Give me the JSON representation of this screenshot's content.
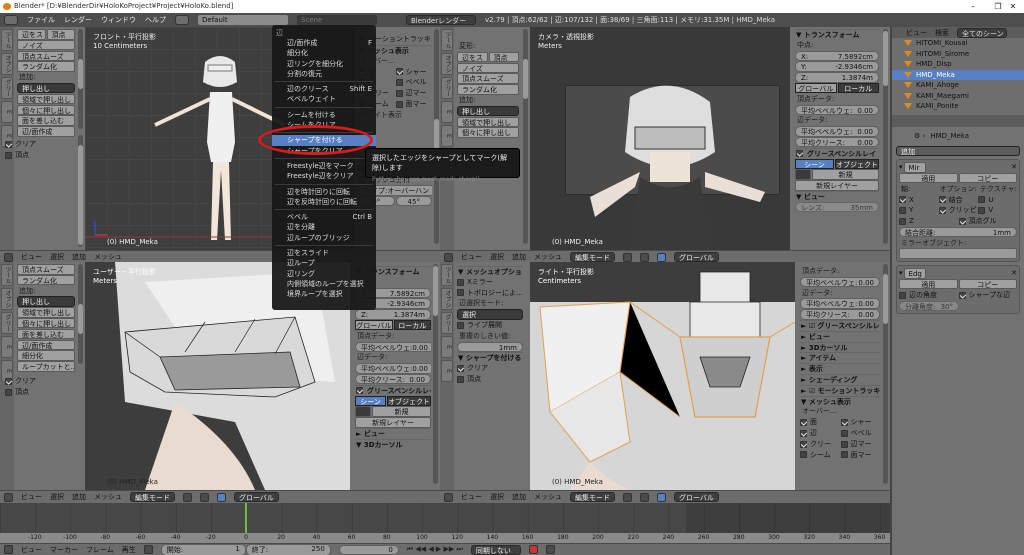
{
  "window": {
    "title": "Blender* [D:¥BlenderDir¥HoloKoProject¥Project¥HoloKo.blend]",
    "minimize": "–",
    "maximize": "❐",
    "close": "✕"
  },
  "topbar": {
    "menus": [
      "ファイル",
      "レンダー",
      "ウィンドウ",
      "ヘルプ"
    ],
    "layout": "Default",
    "scene": "Scene",
    "engine": "Blenderレンダー",
    "stats": "v2.79 | 頂点:62/62 | 辺:107/132 | 面:38/69 | 三角面:113 | メモリ:31.35M | HMD_Meka"
  },
  "tabs": [
    "ツール",
    "オプション",
    "グリース",
    "E",
    "E"
  ],
  "shelf_tl": [
    {
      "t": "btns",
      "items": [
        "辺をス",
        "頂点"
      ]
    },
    {
      "t": "btn",
      "text": "ノイズ"
    },
    {
      "t": "btn",
      "text": "頂点スムーズ"
    },
    {
      "t": "btn",
      "text": "ランダム化"
    },
    {
      "t": "label",
      "text": "追加:"
    },
    {
      "t": "dd",
      "text": "押し出し"
    },
    {
      "t": "btn",
      "text": "領域で押し出し"
    },
    {
      "t": "btn",
      "text": "個々に押し出し"
    },
    {
      "t": "btn",
      "text": "面を差し込む"
    },
    {
      "t": "btn",
      "text": "辺/面作成"
    }
  ],
  "shelf_tl_op": [
    {
      "t": "check",
      "text": "クリア",
      "checked": true
    },
    {
      "t": "check",
      "text": "頂点",
      "checked": false
    }
  ],
  "shelf_tm": [
    {
      "t": "label",
      "text": "変形:"
    },
    {
      "t": "btns",
      "items": [
        "辺をス",
        "頂点"
      ]
    },
    {
      "t": "btn",
      "text": "ノイズ"
    },
    {
      "t": "btn",
      "text": "頂点スムーズ"
    },
    {
      "t": "btn",
      "text": "ランダム化"
    },
    {
      "t": "label",
      "text": "追加:"
    },
    {
      "t": "dd",
      "text": "押し出し"
    },
    {
      "t": "btn",
      "text": "領域で押し出し"
    },
    {
      "t": "btn",
      "text": "個々に押し出し"
    }
  ],
  "shelf_bl": [
    {
      "t": "btn",
      "text": "頂点スムーズ"
    },
    {
      "t": "btn",
      "text": "ランダム化"
    },
    {
      "t": "label",
      "text": "追加:"
    },
    {
      "t": "dd",
      "text": "押し出し"
    },
    {
      "t": "btn",
      "text": "領域で押し出し"
    },
    {
      "t": "btn",
      "text": "個々に押し出し"
    },
    {
      "t": "btn",
      "text": "面を差し込む"
    },
    {
      "t": "btn",
      "text": "辺/面作成"
    },
    {
      "t": "btn",
      "text": "細分化"
    },
    {
      "t": "btn",
      "text": "ループカットと..."
    }
  ],
  "shelf_bl_op": [
    {
      "t": "check",
      "text": "クリア",
      "checked": true
    },
    {
      "t": "check",
      "text": "頂点",
      "checked": false
    }
  ],
  "shelf_bm": [
    {
      "t": "head",
      "text": "▼ メッシュオプション"
    },
    {
      "t": "check",
      "text": "Xミラー",
      "checked": false
    },
    {
      "t": "check",
      "text": "トポロジーによ...",
      "checked": false
    },
    {
      "t": "label",
      "text": "辺選択モード:"
    },
    {
      "t": "dd",
      "text": "選択"
    },
    {
      "t": "check",
      "text": "ライブ展開",
      "checked": false
    },
    {
      "t": "label",
      "text": "重複のしきい値:"
    },
    {
      "t": "field",
      "label": "",
      "value": "1mm"
    },
    {
      "t": "head",
      "text": "▼ シャープを付ける"
    },
    {
      "t": "check",
      "text": "クリア",
      "checked": true
    },
    {
      "t": "check",
      "text": "頂点",
      "checked": false
    }
  ],
  "npanel_tl": [
    {
      "t": "check",
      "text": "モーショントラッキン",
      "checked": true
    },
    {
      "t": "head",
      "text": "▼ メッシュ表示"
    },
    {
      "t": "label",
      "text": "オーバー..."
    },
    {
      "t": "checks",
      "items": [
        {
          "text": "面",
          "checked": true
        },
        {
          "text": "シャー",
          "checked": true
        }
      ]
    },
    {
      "t": "checks",
      "items": [
        {
          "text": "辺",
          "checked": true
        },
        {
          "text": "ベベル",
          "checked": false
        }
      ]
    },
    {
      "t": "checks",
      "items": [
        {
          "text": "クリー",
          "checked": true
        },
        {
          "text": "辺マー",
          "checked": false
        }
      ]
    },
    {
      "t": "checks",
      "items": [
        {
          "text": "シーム",
          "checked": false
        },
        {
          "text": "面マー",
          "checked": false
        }
      ]
    },
    {
      "t": "label",
      "text": "ウェイト表示"
    },
    {
      "t": "label",
      "text": ""
    },
    {
      "t": "label",
      "text": ""
    },
    {
      "t": "label",
      "text": ""
    },
    {
      "t": "checks",
      "items": [
        {
          "text": "長さ",
          "checked": false
        },
        {
          "text": "エリア",
          "checked": false
        }
      ]
    },
    {
      "t": "checks",
      "items": [
        {
          "text": "角度",
          "checked": false
        },
        {
          "text": "角度",
          "checked": false
        }
      ]
    },
    {
      "t": "check",
      "text": "メッシュ分析",
      "checked": false
    },
    {
      "t": "field",
      "label": "タイプ:",
      "value": "オーバーハン"
    },
    {
      "t": "fields",
      "items": [
        "0°",
        "45°"
      ]
    }
  ],
  "transform": {
    "title": "▼ トランスフォーム",
    "median": "中点:",
    "x": "7.5892cm",
    "y": "-2.9346cm",
    "z": "1.3874m",
    "global": "グローバル",
    "local": "ローカル",
    "vdata": "頂点データ:",
    "edata": "辺データ:",
    "bevel": "平均ベベルウェ:",
    "crease": "平均クリース:",
    "zero": "0.00",
    "gp": "グリースペンシルレイ",
    "scene": "シーン",
    "object": "オブジェクト",
    "new": "新規",
    "newlayer": "新規レイヤー",
    "view": "▼ ビュー",
    "lens_label": "レンズ:",
    "lens": "35mm",
    "view_c": "► ビュー",
    "cursor": "▼ 3Dカーソル"
  },
  "npanel_br": [
    {
      "t": "label",
      "text": "頂点データ:"
    },
    {
      "t": "field",
      "label": "平均ベベルウェ:",
      "value": "0.00"
    },
    {
      "t": "label",
      "text": "辺データ:"
    },
    {
      "t": "field",
      "label": "平均ベベルウェ:",
      "value": "0.00"
    },
    {
      "t": "field",
      "label": "平均クリース:",
      "value": "0.00"
    },
    {
      "t": "head",
      "text": "► ☑ グリースペンシルレイ"
    },
    {
      "t": "head",
      "text": "► ビュー"
    },
    {
      "t": "head",
      "text": "► 3Dカーソル"
    },
    {
      "t": "head",
      "text": "► アイテム"
    },
    {
      "t": "head",
      "text": "► 表示"
    },
    {
      "t": "head",
      "text": "► シェーディング"
    },
    {
      "t": "head",
      "text": "► ☑ モーショントラッキン"
    },
    {
      "t": "head",
      "text": "▼ メッシュ表示"
    },
    {
      "t": "label",
      "text": "オーバー..."
    },
    {
      "t": "checks",
      "items": [
        {
          "text": "面",
          "checked": true
        },
        {
          "text": "シャー",
          "checked": true
        }
      ]
    },
    {
      "t": "checks",
      "items": [
        {
          "text": "辺",
          "checked": true
        },
        {
          "text": "ベベル",
          "checked": false
        }
      ]
    },
    {
      "t": "checks",
      "items": [
        {
          "text": "クリー",
          "checked": true
        },
        {
          "text": "辺マー",
          "checked": false
        }
      ]
    },
    {
      "t": "checks",
      "items": [
        {
          "text": "シーム",
          "checked": false
        },
        {
          "text": "面マー",
          "checked": false
        }
      ]
    }
  ],
  "viewports": {
    "tl": {
      "name": "フロント・平行投影",
      "units": "10 Centimeters",
      "object": "(0) HMD_Meka"
    },
    "tr": {
      "name": "カメラ・透視投影",
      "units": "Meters",
      "object": "(0) HMD_Meka"
    },
    "bl": {
      "name": "ユーザー・平行投影",
      "units": "Meters",
      "object": "(0) HMD_Meka"
    },
    "br": {
      "name": "ライト・平行投影",
      "units": "Centimeters",
      "object": "(0) HMD_Meka"
    }
  },
  "header3d": {
    "view": "ビュー",
    "select": "選択",
    "add": "追加",
    "mesh": "メッシュ",
    "mode": "編集モード",
    "orient": "グローバル"
  },
  "menu": {
    "title": "辺",
    "groups": [
      [
        {
          "label": "辺/面作成",
          "key": "F"
        },
        {
          "label": "細分化",
          "key": ""
        },
        {
          "label": "辺リングを細分化",
          "key": ""
        },
        {
          "label": "分割の復元",
          "key": ""
        }
      ],
      [
        {
          "label": "辺のクリース",
          "key": "Shift E"
        },
        {
          "label": "ベベルウェイト",
          "key": ""
        }
      ],
      [
        {
          "label": "シームを付ける",
          "key": ""
        },
        {
          "label": "シームをクリア",
          "key": ""
        }
      ],
      [
        {
          "label": "シャープを付ける",
          "key": "",
          "highlighted": true
        },
        {
          "label": "シャープをクリア",
          "key": ""
        }
      ],
      [
        {
          "label": "Freestyle辺をマーク",
          "key": ""
        },
        {
          "label": "Freestyle辺をクリア",
          "key": ""
        }
      ],
      [
        {
          "label": "辺を時計回りに回転",
          "key": ""
        },
        {
          "label": "辺を反時計回りに回転",
          "key": ""
        }
      ],
      [
        {
          "label": "ベベル",
          "key": "Ctrl B"
        },
        {
          "label": "辺を分離",
          "key": ""
        },
        {
          "label": "辺ループのブリッジ",
          "key": ""
        }
      ],
      [
        {
          "label": "辺をスライド",
          "key": ""
        },
        {
          "label": "辺ループ",
          "key": ""
        },
        {
          "label": "辺リング",
          "key": ""
        },
        {
          "label": "内側領域のループを選択",
          "key": ""
        },
        {
          "label": "境界ループを選択",
          "key": ""
        }
      ]
    ]
  },
  "tooltip": {
    "text": "選択したエッジをシャープとしてマーク(解除)します",
    "python": "Python: bpy.ops.mesh.mark_sharp()"
  },
  "outliner": {
    "view": "ビュー",
    "search": "検索",
    "filter": "全てのシーン",
    "items": [
      {
        "name": "HITOMI_Kousai"
      },
      {
        "name": "HITOMI_Sirome"
      },
      {
        "name": "HMD_Disp"
      },
      {
        "name": "HMD_Meka",
        "selected": true
      },
      {
        "name": "KAMI_Ahoge"
      },
      {
        "name": "KAMI_Maegami"
      },
      {
        "name": "KAMI_Ponite"
      }
    ]
  },
  "properties": {
    "object": "HMD_Meka",
    "add": "追加",
    "mirror": {
      "name": "Mir",
      "apply": "適用",
      "copy": "コピー",
      "axis": "軸:",
      "options": "オプション:",
      "texture": "テクスチャ:",
      "rows": [
        [
          {
            "text": "X",
            "checked": true
          },
          {
            "text": "結合",
            "checked": true
          },
          {
            "text": "U",
            "checked": false
          }
        ],
        [
          {
            "text": "Y",
            "checked": false
          },
          {
            "text": "クリッピ",
            "checked": true
          },
          {
            "text": "V",
            "checked": false
          }
        ],
        [
          {
            "text": "Z",
            "checked": false
          },
          {
            "text": "頂点グル",
            "checked": true
          }
        ]
      ],
      "merge_label": "結合距離:",
      "merge": "1mm",
      "mirror_obj": "ミラーオブジェクト:"
    },
    "edgesplit": {
      "name": "Edg",
      "apply": "適用",
      "copy": "コピー",
      "edge_angle": "辺の角度",
      "edge_angle_on": false,
      "sharp": "シャープな辺",
      "sharp_on": true,
      "split_label": "分離角度:",
      "split": "30°"
    }
  },
  "timeline": {
    "ticks": [
      -120,
      -100,
      -80,
      -60,
      -40,
      -20,
      0,
      20,
      40,
      60,
      80,
      100,
      120,
      140,
      160,
      180,
      200,
      220,
      240,
      260,
      280,
      300,
      320,
      340,
      360
    ],
    "current_frame": 0,
    "menus": [
      "ビュー",
      "マーカー",
      "フレーム",
      "再生"
    ],
    "start_label": "開始:",
    "start": "1",
    "end_label": "終了:",
    "end": "250",
    "frame": "0",
    "sync": "同期しない"
  },
  "colors": {
    "accent": "#5680c2",
    "highlight_ring": "#d81b1b",
    "frame_line": "#6fbf3a",
    "panel": "#727272"
  }
}
